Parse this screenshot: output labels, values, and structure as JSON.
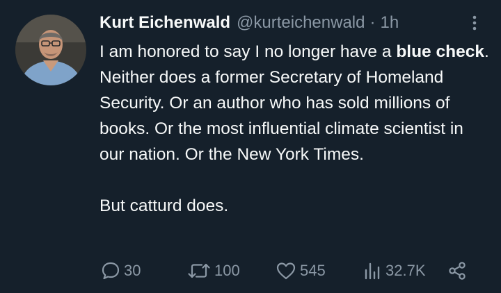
{
  "tweet": {
    "author": {
      "display_name": "Kurt Eichenwald",
      "handle": "@kurteichenwald"
    },
    "separator": "·",
    "time": "1h",
    "text": {
      "before_bold": "I am honored to say I no longer have a ",
      "bold": "blue check",
      "after_bold": ". Neither does a former Secretary of Homeland Security. Or an author who has sold millions of books. Or the most influential climate scientist in our nation. Or the New York Times.",
      "closing": "But catturd does."
    },
    "metrics": {
      "replies": "30",
      "retweets": "100",
      "likes": "545",
      "views": "32.7K"
    }
  },
  "icons": {
    "more": "more-vertical-icon",
    "reply": "reply-bubble-icon",
    "retweet": "retweet-icon",
    "like": "heart-icon",
    "views": "views-chart-icon",
    "share": "share-icon"
  },
  "colors": {
    "background": "#15202b",
    "text": "#f7f9f9",
    "secondary": "#8b98a5"
  }
}
